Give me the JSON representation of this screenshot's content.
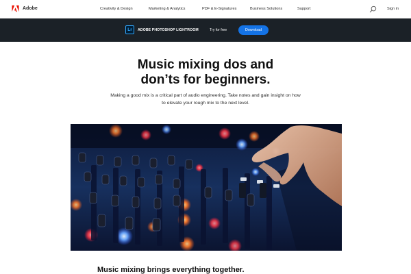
{
  "nav": {
    "brand": "Adobe",
    "items": [
      "Creativity & Design",
      "Marketing & Analytics",
      "PDF & E-Signatures",
      "Business Solutions",
      "Support"
    ],
    "search_icon": "search-icon",
    "signin": "Sign in"
  },
  "promo": {
    "badge": "Lr",
    "product": "ADOBE PHOTOSHOP LIGHTROOM",
    "try_label": "Try for free",
    "download_label": "Download"
  },
  "hero": {
    "headline_line1": "Music mixing dos and",
    "headline_line2": "don’ts for beginners.",
    "subtext": "Making a good mix is a critical part of audio engineering. Take notes and gain insight on how to elevate your rough mix to the next level."
  },
  "section": {
    "heading": "Music mixing brings everything together."
  },
  "colors": {
    "accent": "#1473e6",
    "promo_bg": "#1b2127",
    "lightroom_blue": "#31a8ff"
  }
}
